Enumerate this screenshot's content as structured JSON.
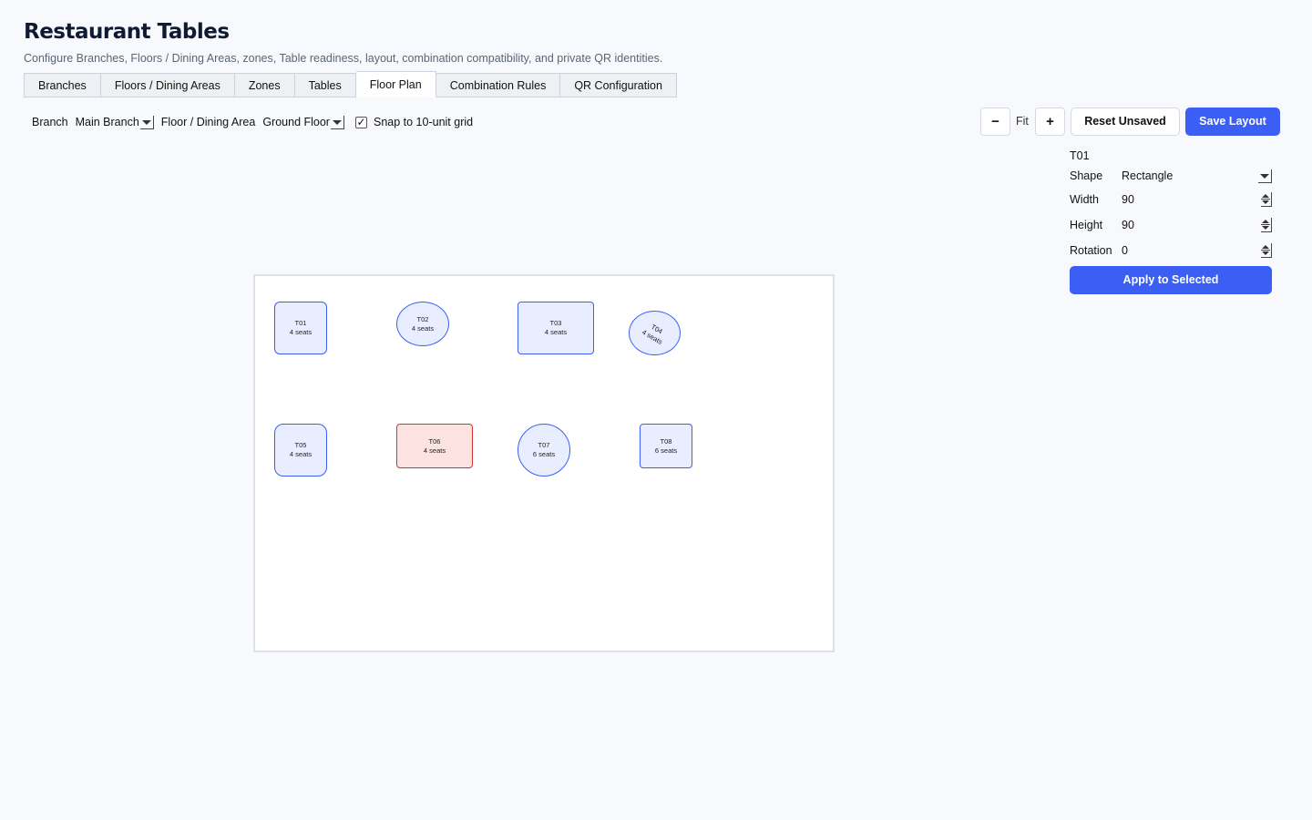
{
  "header": {
    "title": "Restaurant Tables",
    "subtitle": "Configure Branches, Floors / Dining Areas, zones, Table readiness, layout, combination compatibility, and private QR identities."
  },
  "tabs": [
    {
      "label": "Branches",
      "active": false
    },
    {
      "label": "Floors / Dining Areas",
      "active": false
    },
    {
      "label": "Zones",
      "active": false
    },
    {
      "label": "Tables",
      "active": false
    },
    {
      "label": "Floor Plan",
      "active": true
    },
    {
      "label": "Combination Rules",
      "active": false
    },
    {
      "label": "QR Configuration",
      "active": false
    }
  ],
  "toolbar": {
    "branch_label": "Branch",
    "branch_value": "Main Branch",
    "floor_label": "Floor / Dining Area",
    "floor_value": "Ground Floor",
    "snap_checked": "✓",
    "snap_label": "Snap to 10-unit grid",
    "zoom_out_label": "−",
    "zoom_fit_label": "Fit",
    "zoom_in_label": "+",
    "reset_label": "Reset Unsaved",
    "save_label": "Save Layout"
  },
  "tables": [
    {
      "id": "T01",
      "seats": "4 seats",
      "shape": "square",
      "status": "normal",
      "rotation": 0
    },
    {
      "id": "T02",
      "seats": "4 seats",
      "shape": "ellipse",
      "status": "normal",
      "rotation": 0
    },
    {
      "id": "T03",
      "seats": "4 seats",
      "shape": "rectangle",
      "status": "normal",
      "rotation": 0
    },
    {
      "id": "T04",
      "seats": "4 seats",
      "shape": "ellipse",
      "status": "normal",
      "rotation": 30
    },
    {
      "id": "T05",
      "seats": "4 seats",
      "shape": "square",
      "status": "normal",
      "rotation": 0
    },
    {
      "id": "T06",
      "seats": "4 seats",
      "shape": "rectangle",
      "status": "conflict",
      "rotation": 0
    },
    {
      "id": "T07",
      "seats": "6 seats",
      "shape": "circle",
      "status": "normal",
      "rotation": 0
    },
    {
      "id": "T08",
      "seats": "6 seats",
      "shape": "rectangle",
      "status": "normal",
      "rotation": 0
    }
  ],
  "colors": {
    "accent": "#3b5ff5",
    "table_fill": "#e8edff",
    "conflict_fill": "#fde2e2",
    "conflict_border": "#d93030"
  },
  "properties": {
    "selected": "T01",
    "shape_label": "Shape",
    "shape_value": "Rectangle",
    "width_label": "Width",
    "width_value": "90",
    "height_label": "Height",
    "height_value": "90",
    "rotation_label": "Rotation",
    "rotation_value": "0",
    "apply_label": "Apply to Selected"
  }
}
